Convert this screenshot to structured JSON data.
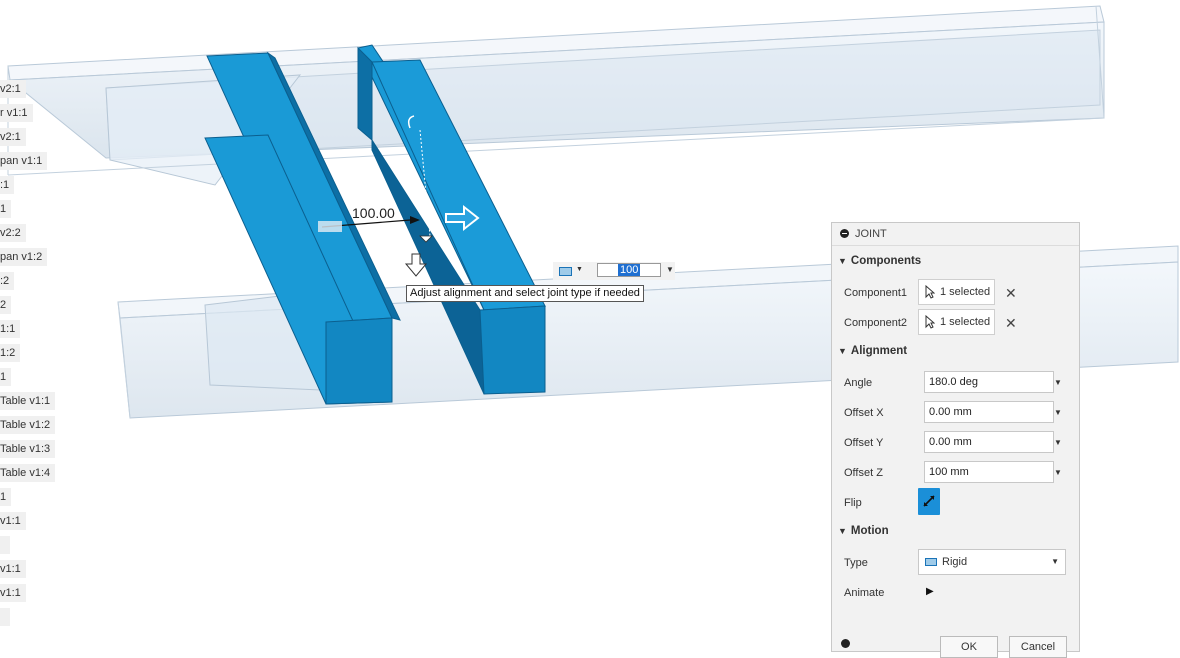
{
  "browser": {
    "items": [
      "v2:1",
      "r v1:1",
      "v2:1",
      "pan v1:1",
      ":1",
      "1",
      "v2:2",
      "pan v1:2",
      ":2",
      "2",
      "1:1",
      "1:2",
      "1",
      "Table v1:1",
      "Table v1:2",
      "Table v1:3",
      "Table v1:4",
      "1",
      "v1:1",
      "",
      "v1:1",
      "v1:1",
      ""
    ]
  },
  "canvas": {
    "dimension_label": "100.00",
    "tooltip": "Adjust alignment and select joint type if needed",
    "mini_toolbar": {
      "value": "100",
      "type_icon": "rigid-joint-icon"
    }
  },
  "joint_panel": {
    "title": "JOINT",
    "sections": {
      "components": "Components",
      "alignment": "Alignment",
      "motion": "Motion"
    },
    "component1": {
      "label": "Component1",
      "value": "1 selected"
    },
    "component2": {
      "label": "Component2",
      "value": "1 selected"
    },
    "angle": {
      "label": "Angle",
      "value": "180.0 deg"
    },
    "offset_x": {
      "label": "Offset X",
      "value": "0.00 mm"
    },
    "offset_y": {
      "label": "Offset Y",
      "value": "0.00 mm"
    },
    "offset_z": {
      "label": "Offset Z",
      "value": "100 mm"
    },
    "flip": {
      "label": "Flip"
    },
    "type": {
      "label": "Type",
      "value": "Rigid"
    },
    "animate": {
      "label": "Animate"
    },
    "ok_label": "OK",
    "cancel_label": "Cancel"
  },
  "colors": {
    "selected_part": "#1a9ad6",
    "accent": "#1b8fd8",
    "panel_bg": "#f2f2f2"
  }
}
